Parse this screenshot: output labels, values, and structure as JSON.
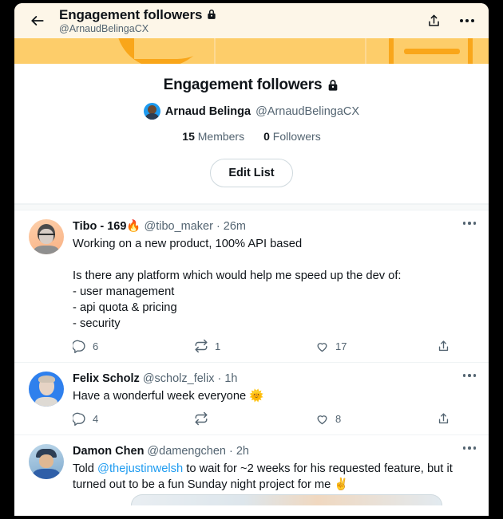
{
  "topbar": {
    "back_icon": "arrow-left-icon",
    "title": "Engagement followers",
    "lock_icon": "lock-icon",
    "subtitle": "@ArnaudBelingaCX",
    "share_icon": "share-icon",
    "more_icon": "more-horizontal-icon"
  },
  "list": {
    "title": "Engagement followers",
    "lock_icon": "lock-icon",
    "owner": {
      "avatar": "avatar-arnaud",
      "name": "Arnaud Belinga",
      "handle": "@ArnaudBelingaCX"
    },
    "stats": [
      {
        "count": "15",
        "label": "Members"
      },
      {
        "count": "0",
        "label": "Followers"
      }
    ],
    "edit_button": "Edit List"
  },
  "colors": {
    "accent_blue": "#1d9bf0",
    "banner_light": "#fdcd6a",
    "banner_dark": "#f9a61a",
    "header_cream": "#fdf6e8",
    "text_primary": "#0f1419",
    "text_secondary": "#536471"
  },
  "tweets": [
    {
      "avatar": "avatar-tibo",
      "name": "Tibo - 169🔥",
      "handle": "@tibo_maker",
      "separator": "·",
      "time": "26m",
      "text": "Working on a new product, 100% API based\n\nIs there any platform which would help me speed up the dev of:\n- user management\n- api quota & pricing\n- security",
      "more_icon": "more-horizontal-icon",
      "actions": {
        "reply_icon": "reply-icon",
        "reply_count": "6",
        "retweet_icon": "retweet-icon",
        "retweet_count": "1",
        "like_icon": "heart-icon",
        "like_count": "17",
        "share_icon": "share-icon"
      }
    },
    {
      "avatar": "avatar-felix",
      "name": "Felix Scholz",
      "handle": "@scholz_felix",
      "separator": "·",
      "time": "1h",
      "text": "Have a wonderful week everyone 🌞",
      "more_icon": "more-horizontal-icon",
      "actions": {
        "reply_icon": "reply-icon",
        "reply_count": "4",
        "retweet_icon": "retweet-icon",
        "retweet_count": "",
        "like_icon": "heart-icon",
        "like_count": "8",
        "share_icon": "share-icon"
      }
    },
    {
      "avatar": "avatar-damon",
      "name": "Damon Chen",
      "handle": "@damengchen",
      "separator": "·",
      "time": "2h",
      "text_before": "Told ",
      "mention": "@thejustinwelsh",
      "text_after": " to wait for ~2 weeks for his requested feature, but it turned out to be a fun Sunday night project for me ✌️",
      "more_icon": "more-horizontal-icon"
    }
  ]
}
